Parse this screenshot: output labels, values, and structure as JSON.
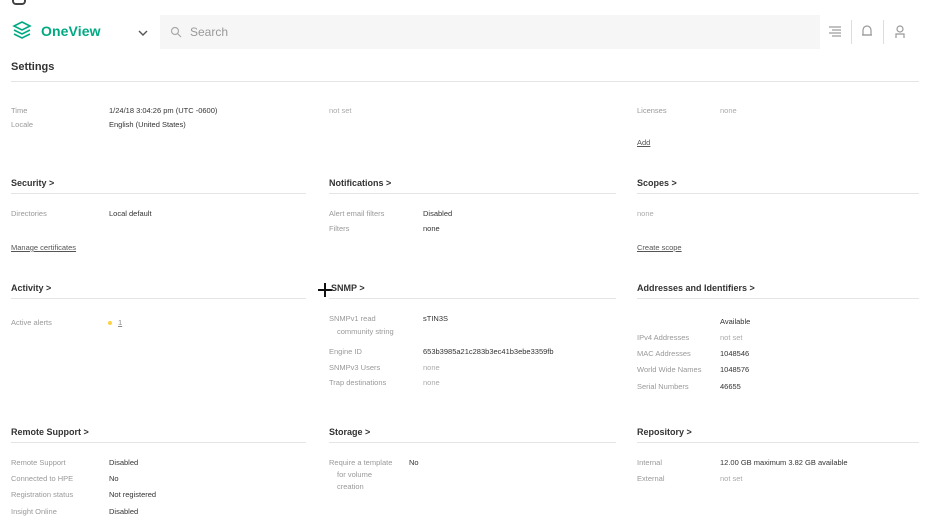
{
  "header": {
    "app_name": "OneView",
    "search_placeholder": "Search",
    "icons": [
      "app-logo-icon",
      "chevron-down-icon",
      "search-icon",
      "activity-list-icon",
      "notification-bell-icon",
      "user-icon"
    ]
  },
  "page": {
    "title": "Settings"
  },
  "general": {
    "time_label": "Time",
    "time_value": "1/24/18 3:04:26 pm (UTC -0600)",
    "locale_label": "Locale",
    "locale_value": "English (United States)",
    "middle_value": "not set",
    "licenses_label": "Licenses",
    "licenses_value": "none",
    "add_link": "Add"
  },
  "security": {
    "title": "Security >",
    "directories_label": "Directories",
    "directories_value": "Local default",
    "manage_link": "Manage certificates"
  },
  "notifications": {
    "title": "Notifications >",
    "alert_filters_label": "Alert email filters",
    "alert_filters_value": "Disabled",
    "filters_label": "Filters",
    "filters_value": "none"
  },
  "scopes": {
    "title": "Scopes >",
    "value": "none",
    "create_link": "Create scope"
  },
  "activity": {
    "title": "Activity >",
    "active_alerts_label": "Active alerts",
    "active_alerts_value": "1"
  },
  "snmp": {
    "title": "SNMP >",
    "read_label_1": "SNMPv1 read",
    "read_label_2": "community string",
    "read_value": "sTIN3S",
    "engine_label": "Engine ID",
    "engine_value": "653b3985a21c283b3ec41b3ebe3359fb",
    "users_label": "SNMPv3 Users",
    "users_value": "none",
    "trap_label": "Trap destinations",
    "trap_value": "none"
  },
  "addresses": {
    "title": "Addresses and Identifiers >",
    "available_header": "Available",
    "ipv4_label": "IPv4 Addresses",
    "ipv4_value": "not set",
    "mac_label": "MAC Addresses",
    "mac_value": "1048546",
    "wwn_label": "World Wide Names",
    "wwn_value": "1048576",
    "serial_label": "Serial Numbers",
    "serial_value": "46655"
  },
  "remote_support": {
    "title": "Remote Support >",
    "rs_label": "Remote Support",
    "rs_value": "Disabled",
    "connected_label": "Connected to HPE",
    "connected_value": "No",
    "registration_label": "Registration status",
    "registration_value": "Not registered",
    "insight_label": "Insight Online",
    "insight_value": "Disabled"
  },
  "storage": {
    "title": "Storage >",
    "template_label_1": "Require a template",
    "template_label_2": "for volume",
    "template_label_3": "creation",
    "template_value": "No"
  },
  "repository": {
    "title": "Repository >",
    "internal_label": "Internal",
    "internal_value": "12.00 GB maximum 3.82 GB available",
    "external_label": "External",
    "external_value": "not set"
  },
  "colors": {
    "brand": "#01a982",
    "alert": "#ffd144"
  }
}
